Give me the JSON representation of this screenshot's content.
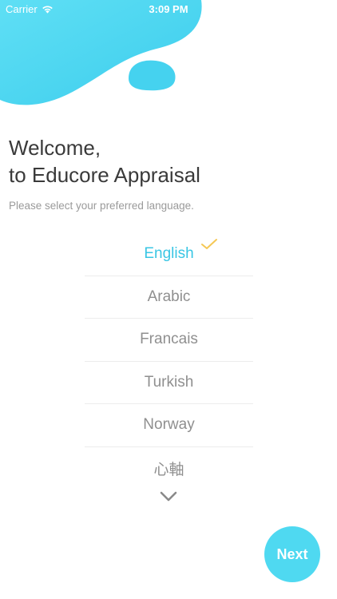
{
  "status_bar": {
    "carrier": "Carrier",
    "time": "3:09 PM",
    "wifi_icon": "wifi-icon"
  },
  "header": {
    "title_line1": "Welcome,",
    "title_line2": "to Educore Appraisal",
    "subtitle": "Please select your preferred language."
  },
  "languages": {
    "selected": "English",
    "items": [
      {
        "label": "English",
        "selected": true
      },
      {
        "label": "Arabic",
        "selected": false
      },
      {
        "label": "Francais",
        "selected": false
      },
      {
        "label": "Turkish",
        "selected": false
      },
      {
        "label": "Norway",
        "selected": false
      },
      {
        "label": "心軸",
        "selected": false
      }
    ],
    "check_icon": "check-icon",
    "more_icon": "chevron-down-icon"
  },
  "footer": {
    "next_label": "Next"
  },
  "colors": {
    "accent": "#39c6e4",
    "blob": "#4dd7f2",
    "check": "#f5c855",
    "next_button": "#4fd9f1",
    "title_text": "#3a3a3a",
    "muted_text": "#9a9a9a"
  }
}
